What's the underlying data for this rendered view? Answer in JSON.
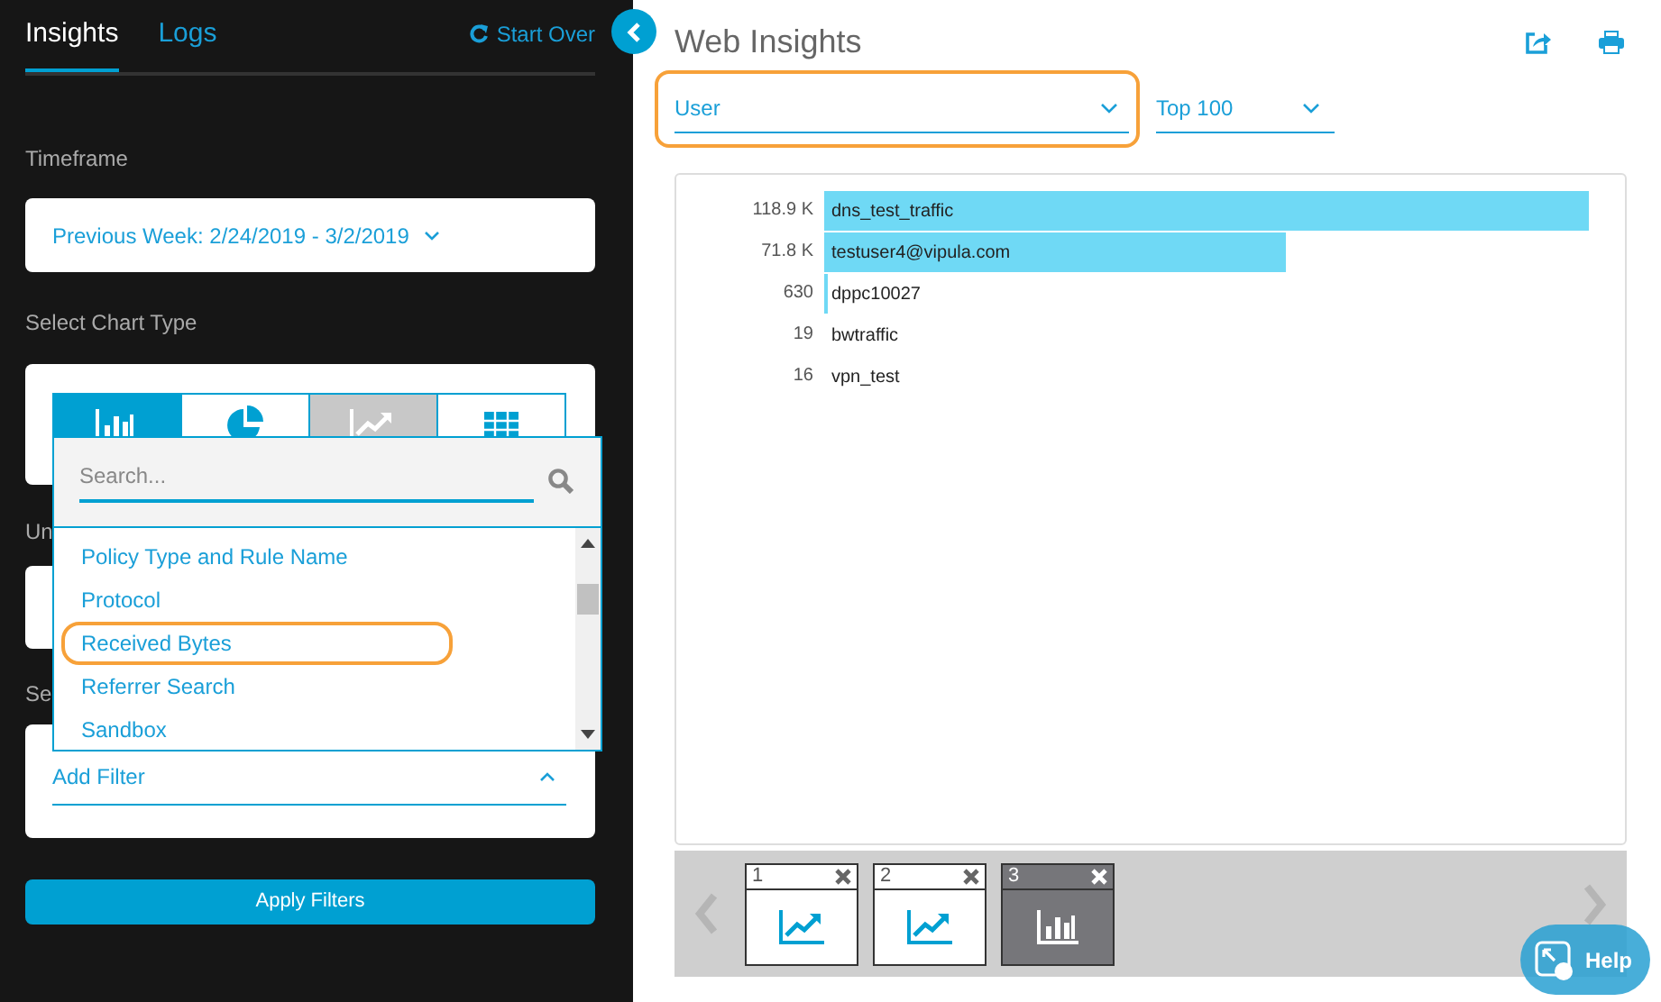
{
  "sidebar": {
    "tabs": [
      {
        "label": "Insights",
        "selected": true
      },
      {
        "label": "Logs",
        "selected": false
      }
    ],
    "start_over": "Start Over",
    "timeframe": {
      "label": "Timeframe",
      "value": "Previous Week: 2/24/2019 - 3/2/2019"
    },
    "chart_type": {
      "label": "Select Chart Type",
      "options": [
        {
          "kind": "bar",
          "selected": true,
          "disabled": false
        },
        {
          "kind": "pie",
          "selected": false,
          "disabled": false
        },
        {
          "kind": "line",
          "selected": false,
          "disabled": true
        },
        {
          "kind": "table",
          "selected": false,
          "disabled": false
        }
      ]
    },
    "section_3_label": "Un",
    "section_4_label": "Se",
    "filter": {
      "label": "Add Filter"
    },
    "dropdown": {
      "placeholder": "Search...",
      "items": [
        {
          "label": "Policy Type and Rule Name",
          "highlighted": false
        },
        {
          "label": "Protocol",
          "highlighted": false
        },
        {
          "label": "Received Bytes",
          "highlighted": true
        },
        {
          "label": "Referrer Search",
          "highlighted": false
        },
        {
          "label": "Sandbox",
          "highlighted": false
        }
      ]
    },
    "apply_button": "Apply Filters"
  },
  "main": {
    "title": "Web Insights",
    "group_by": {
      "value": "User",
      "highlighted": true
    },
    "limit": {
      "value": "Top 100"
    },
    "chart": {
      "chart_data": {
        "type": "bar",
        "orientation": "horizontal",
        "categories": [
          "dns_test_traffic",
          "testuser4@vipula.com",
          "dppc10027",
          "bwtraffic",
          "vpn_test"
        ],
        "values": [
          118900,
          71800,
          630,
          19,
          16
        ],
        "value_labels": [
          "118.9 K",
          "71.8 K",
          "630",
          "19",
          "16"
        ]
      }
    },
    "thumbnails": [
      {
        "number": "1",
        "kind": "line",
        "selected": false
      },
      {
        "number": "2",
        "kind": "line",
        "selected": false
      },
      {
        "number": "3",
        "kind": "bar",
        "selected": true
      }
    ],
    "help_button": "Help"
  }
}
